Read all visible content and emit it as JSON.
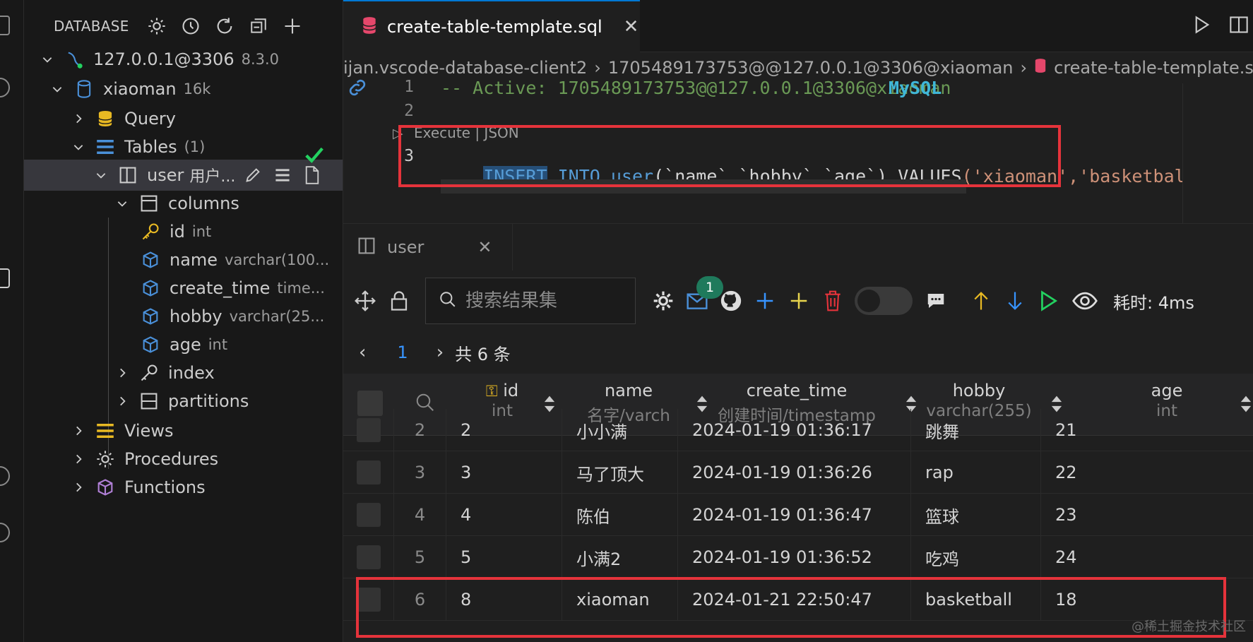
{
  "sidebar": {
    "title": "DATABASE",
    "tree": {
      "connection": {
        "label": "127.0.0.1@3306",
        "version": "8.3.0"
      },
      "database": {
        "label": "xiaoman",
        "size": "16k"
      },
      "query": {
        "label": "Query"
      },
      "tables": {
        "label": "Tables",
        "count": "(1)"
      },
      "table": {
        "label": "user",
        "comment": "用户..."
      },
      "columns": {
        "label": "columns"
      },
      "cols": [
        {
          "name": "id",
          "type": "int"
        },
        {
          "name": "name",
          "type": "varchar(100..."
        },
        {
          "name": "create_time",
          "type": "time..."
        },
        {
          "name": "hobby",
          "type": "varchar(25..."
        },
        {
          "name": "age",
          "type": "int"
        }
      ],
      "index": {
        "label": "index"
      },
      "partitions": {
        "label": "partitions"
      },
      "views": {
        "label": "Views"
      },
      "procedures": {
        "label": "Procedures"
      },
      "functions": {
        "label": "Functions"
      }
    }
  },
  "editor": {
    "tab_label": "create-table-template.sql",
    "breadcrumb": [
      "ijan.vscode-database-client2",
      "1705489173753@@127.0.0.1@3306@xiaoman",
      "create-table-template.sql"
    ],
    "line1_num": "1",
    "line2_num": "2",
    "line3_num": "3",
    "line1_comment": "-- Active: 1705489173753@@127.0.0.1@3306@xiaoman",
    "line1_dialect": "MySQL",
    "codelens": "Execute | JSON",
    "line3": {
      "kw1": "INSERT",
      "kw2": "INTO",
      "table": "user",
      "cols": "(`name`,`hobby`,`age`)",
      "values_kw": "VALUES",
      "values": "('xiaoman','basketbal"
    }
  },
  "results": {
    "tab_label": "user",
    "search_placeholder": "搜索结果集",
    "badge_count": "1",
    "timing": "耗时: 4ms",
    "pager": {
      "page": "1",
      "total": "共 6 条"
    },
    "columns": [
      {
        "name": "id",
        "type": "int"
      },
      {
        "name": "name",
        "type": "名字/varch"
      },
      {
        "name": "create_time",
        "type": "创建时间/timestamp"
      },
      {
        "name": "hobby",
        "type": "varchar(255)"
      },
      {
        "name": "age",
        "type": "int"
      }
    ],
    "rows": [
      {
        "n": "2",
        "id": "2",
        "name": "小小满",
        "create_time": "2024-01-19 01:36:17",
        "hobby": "跳舞",
        "age": "21"
      },
      {
        "n": "3",
        "id": "3",
        "name": "马了顶大",
        "create_time": "2024-01-19 01:36:26",
        "hobby": "rap",
        "age": "22"
      },
      {
        "n": "4",
        "id": "4",
        "name": "陈伯",
        "create_time": "2024-01-19 01:36:47",
        "hobby": "篮球",
        "age": "23"
      },
      {
        "n": "5",
        "id": "5",
        "name": "小满2",
        "create_time": "2024-01-19 01:36:52",
        "hobby": "吃鸡",
        "age": "24"
      },
      {
        "n": "6",
        "id": "8",
        "name": "xiaoman",
        "create_time": "2024-01-21 22:50:47",
        "hobby": "basketball",
        "age": "18"
      }
    ]
  },
  "watermark": "@稀土掘金技术社区",
  "colors": {
    "accent": "#0078d4",
    "highlight_box": "#e5333b",
    "comment": "#6a9955",
    "keyword": "#569cd6",
    "string": "#ce9178"
  }
}
